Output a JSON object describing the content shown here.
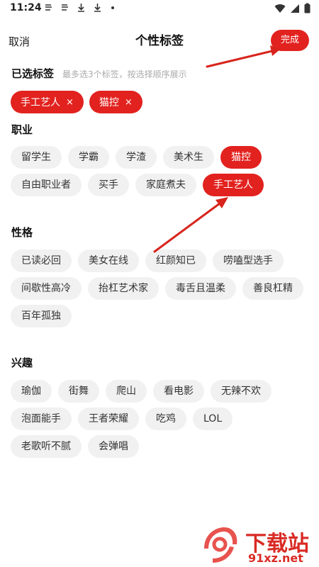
{
  "status_bar": {
    "time": "11:24",
    "left_icons": [
      "signal-app-icon",
      "signal-app-icon",
      "download-icon",
      "download-icon",
      "dot-icon"
    ],
    "right_icons": [
      "wifi-icon",
      "cell-signal-icon",
      "battery-icon"
    ]
  },
  "header": {
    "cancel_label": "取消",
    "title": "个性标签",
    "done_label": "完成"
  },
  "selected": {
    "title": "已选标签",
    "hint": "最多选3个标签，按选择顺序展示",
    "items": [
      {
        "label": "手工艺人",
        "remove": "×"
      },
      {
        "label": "猫控",
        "remove": "×"
      }
    ]
  },
  "sections": [
    {
      "title": "职业",
      "rows": [
        [
          {
            "label": "留学生",
            "active": false
          },
          {
            "label": "学霸",
            "active": false
          },
          {
            "label": "学渣",
            "active": false
          },
          {
            "label": "美术生",
            "active": false
          },
          {
            "label": "猫控",
            "active": true
          }
        ],
        [
          {
            "label": "自由职业者",
            "active": false
          },
          {
            "label": "买手",
            "active": false
          },
          {
            "label": "家庭煮夫",
            "active": false
          },
          {
            "label": "手工艺人",
            "active": true
          }
        ]
      ]
    },
    {
      "title": "性格",
      "rows": [
        [
          {
            "label": "已读必回",
            "active": false
          },
          {
            "label": "美女在线",
            "active": false
          },
          {
            "label": "红颜知已",
            "active": false
          },
          {
            "label": "唠嗑型选手",
            "active": false
          }
        ],
        [
          {
            "label": "间歇性高冷",
            "active": false
          },
          {
            "label": "抬杠艺术家",
            "active": false
          },
          {
            "label": "毒舌且温柔",
            "active": false
          },
          {
            "label": "善良杠精",
            "active": false
          }
        ],
        [
          {
            "label": "百年孤独",
            "active": false
          }
        ]
      ]
    },
    {
      "title": "兴趣",
      "rows": [
        [
          {
            "label": "瑜伽",
            "active": false
          },
          {
            "label": "街舞",
            "active": false
          },
          {
            "label": "爬山",
            "active": false
          },
          {
            "label": "看电影",
            "active": false
          },
          {
            "label": "无辣不欢",
            "active": false
          }
        ],
        [
          {
            "label": "泡面能手",
            "active": false
          },
          {
            "label": "王者荣耀",
            "active": false
          },
          {
            "label": "吃鸡",
            "active": false
          },
          {
            "label": "LOL",
            "active": false
          }
        ],
        [
          {
            "label": "老歌听不腻",
            "active": false
          },
          {
            "label": "会弹唱",
            "active": false
          }
        ]
      ]
    }
  ],
  "watermark": {
    "text": "下载站",
    "url": "91xz.net"
  },
  "colors": {
    "accent": "#e2221f",
    "tag_bg": "#f1f1f1",
    "arrow": "#d8241c"
  }
}
